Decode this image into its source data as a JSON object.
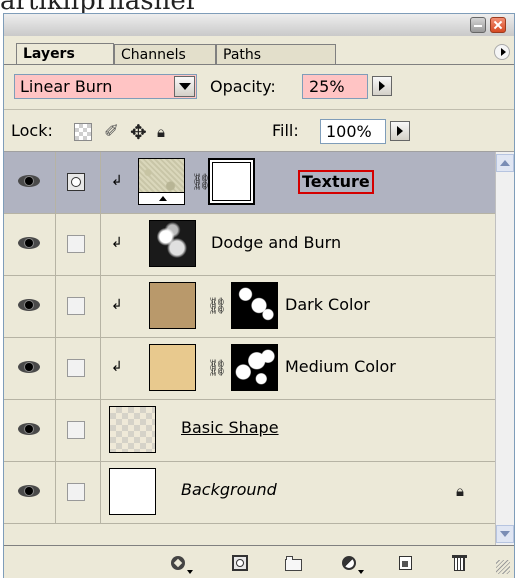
{
  "page_header_text": "artikliprilasher",
  "panel": {
    "tabs": [
      {
        "label": "Layers"
      },
      {
        "label": "Channels"
      },
      {
        "label": "Paths"
      }
    ],
    "blend_mode": "Linear Burn",
    "opacity_label": "Opacity:",
    "opacity_value": "25%",
    "lock_label": "Lock:",
    "fill_label": "Fill:",
    "fill_value": "100%",
    "colors": {
      "selected_row": "#b0b3c1",
      "highlight_field": "#ffc4c4",
      "dark_color_swatch": "#b9996b",
      "medium_color_swatch": "#e8c98e",
      "texture_outline": "#d40000"
    },
    "layers": [
      {
        "name": "Texture",
        "selected": true,
        "clipped": true,
        "mask_linked": true
      },
      {
        "name": "Dodge and Burn",
        "selected": false,
        "clipped": true,
        "mask_linked": false
      },
      {
        "name": "Dark Color",
        "selected": false,
        "clipped": true,
        "mask_linked": true
      },
      {
        "name": "Medium Color",
        "selected": false,
        "clipped": true,
        "mask_linked": true
      },
      {
        "name": "Basic Shape",
        "selected": false,
        "clipped": false,
        "mask_linked": false
      },
      {
        "name": "Background",
        "selected": false,
        "clipped": false,
        "mask_linked": false,
        "locked": true
      }
    ],
    "bottom_icons": [
      "layer-style-icon",
      "add-mask-icon",
      "new-group-icon",
      "adjustment-layer-icon",
      "new-layer-icon",
      "delete-layer-icon"
    ]
  }
}
